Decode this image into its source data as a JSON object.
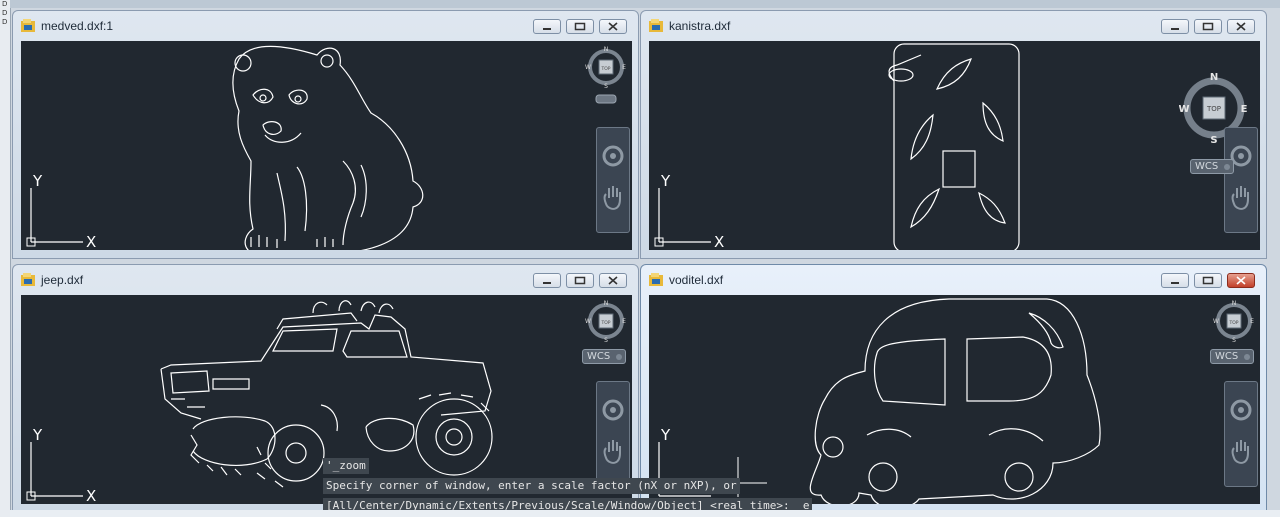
{
  "edge_letters": [
    "D",
    "D",
    "D"
  ],
  "windows": [
    {
      "title": "medved.dxf:1",
      "viewcube": {
        "n": "N",
        "s": "S",
        "e": "E",
        "w": "W",
        "face": "TOP"
      },
      "ucs": {
        "x": "X",
        "y": "Y"
      }
    },
    {
      "title": "kanistra.dxf",
      "viewcube": {
        "n": "N",
        "s": "S",
        "e": "E",
        "w": "W",
        "face": "TOP"
      },
      "wcs": "WCS",
      "ucs": {
        "x": "X",
        "y": "Y"
      }
    },
    {
      "title": "jeep.dxf",
      "viewcube": {
        "n": "N",
        "s": "S",
        "e": "E",
        "w": "W",
        "face": "TOP"
      },
      "wcs": "WCS",
      "ucs": {
        "x": "X",
        "y": "Y"
      }
    },
    {
      "title": "voditel.dxf",
      "viewcube": {
        "n": "N",
        "s": "S",
        "e": "E",
        "w": "W",
        "face": "TOP"
      },
      "wcs": "WCS",
      "ucs": {
        "x": "X",
        "y": "Y"
      }
    }
  ],
  "command": {
    "line1": "'_zoom",
    "line2": "Specify corner of window, enter a scale factor (nX or nXP), or",
    "line3": "[All/Center/Dynamic/Extents/Previous/Scale/Window/Object] <real time>: _e"
  },
  "colors": {
    "viewport_bg": "#212830",
    "drawing_line": "#ffffff",
    "close_active": "#c2402a"
  },
  "icons": [
    "minimize-icon",
    "restore-icon",
    "close-icon",
    "pan-hand-icon",
    "steering-wheel-icon",
    "dxf-file-icon"
  ]
}
